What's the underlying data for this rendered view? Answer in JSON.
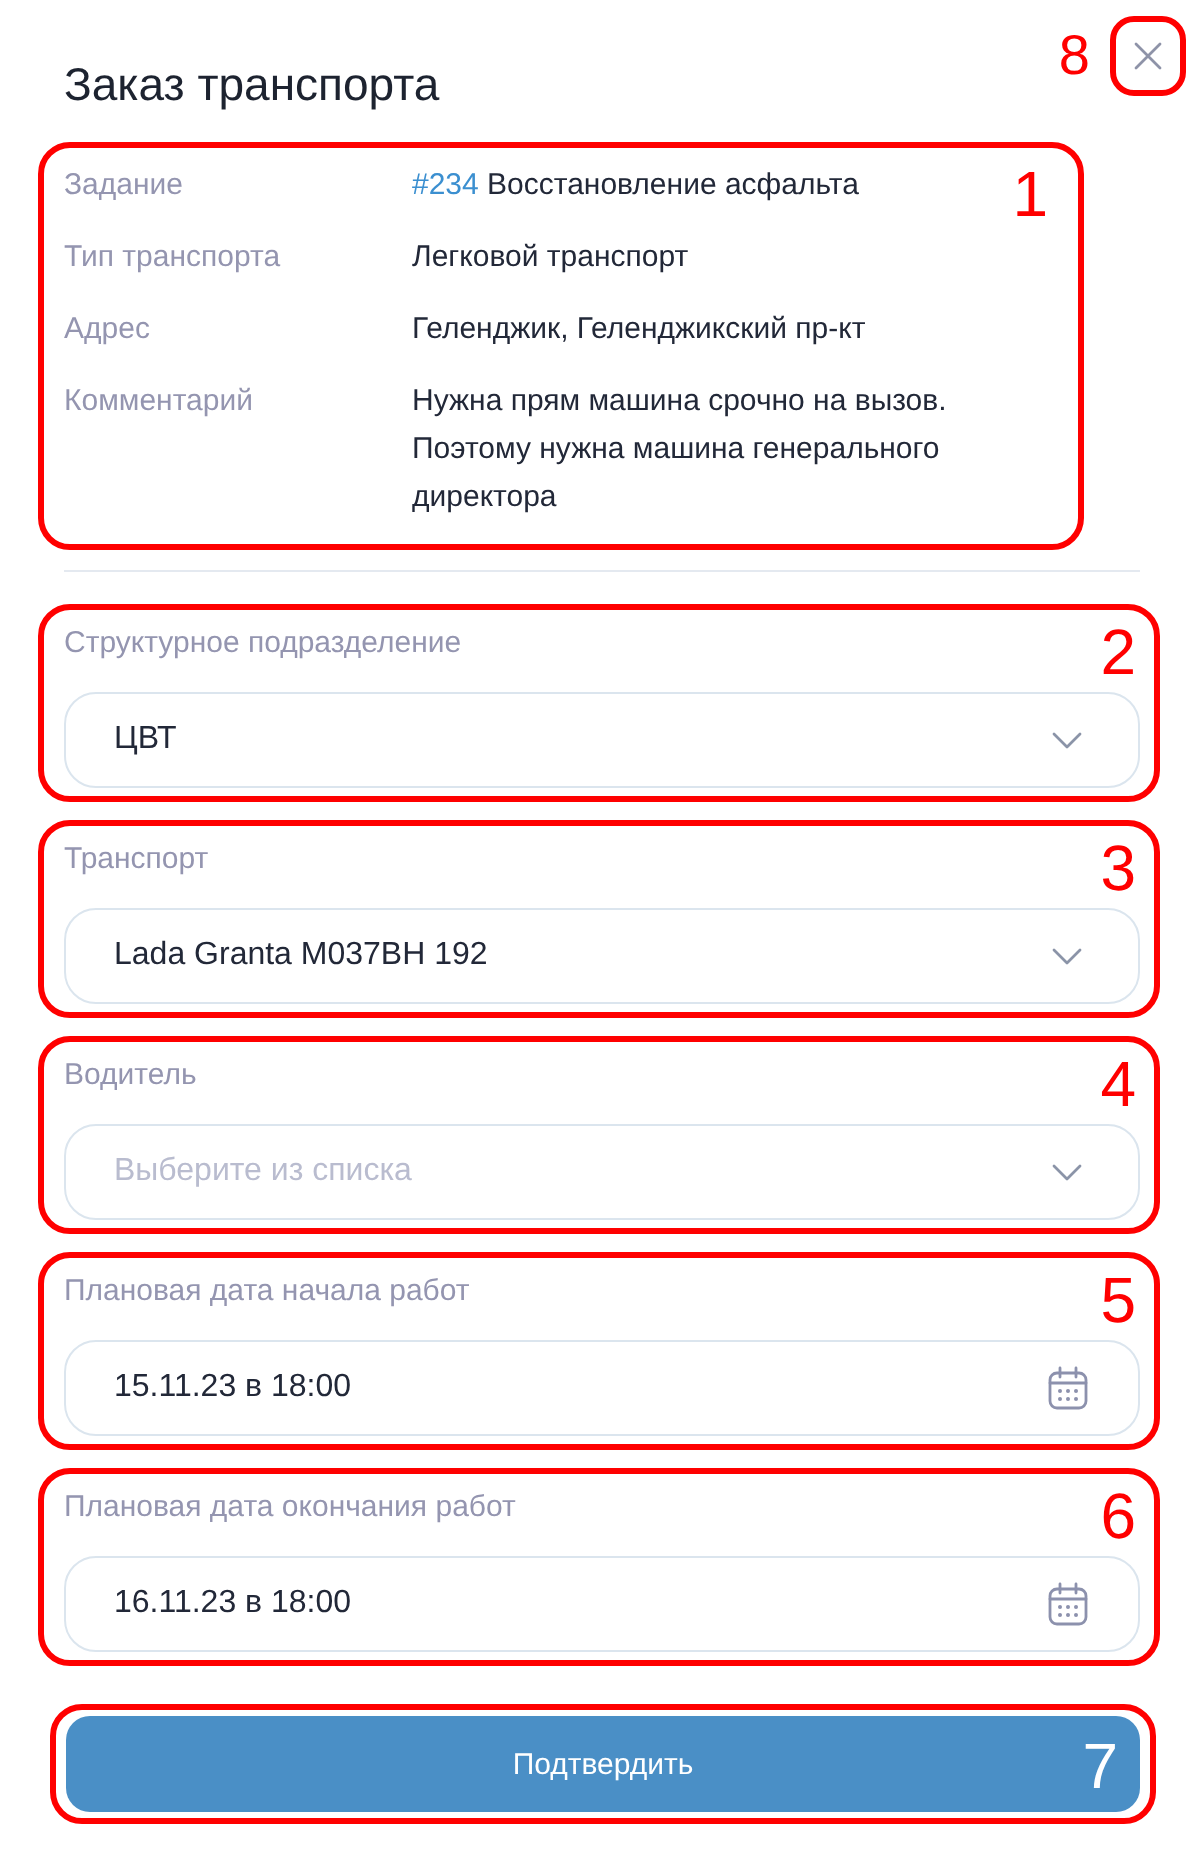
{
  "title": "Заказ транспорта",
  "close_button": {
    "annotation": "8"
  },
  "details": {
    "annotation": "1",
    "rows": [
      {
        "label": "Задание",
        "link": "#234",
        "value": "Восстановление асфальта"
      },
      {
        "label": "Тип транспорта",
        "value": "Легковой транспорт"
      },
      {
        "label": "Адрес",
        "value": "Геленджик, Геленджикский пр-кт"
      },
      {
        "label": "Комментарий",
        "value": "Нужна прям машина срочно на вызов. Поэтому нужна машина генерального директора"
      }
    ]
  },
  "fields": [
    {
      "kind": "select",
      "label": "Структурное подразделение",
      "value": "ЦВТ",
      "annotation": "2"
    },
    {
      "kind": "select",
      "label": "Транспорт",
      "value": "Lada Granta M037BH 192",
      "annotation": "3"
    },
    {
      "kind": "select",
      "label": "Водитель",
      "placeholder": "Выберите из списка",
      "annotation": "4"
    },
    {
      "kind": "date",
      "label": "Плановая дата начала работ",
      "value": "15.11.23 в 18:00",
      "annotation": "5"
    },
    {
      "kind": "date",
      "label": "Плановая дата окончания работ",
      "value": "16.11.23 в 18:00",
      "annotation": "6"
    }
  ],
  "submit_button": {
    "label": "Подтвердить",
    "annotation": "7"
  }
}
